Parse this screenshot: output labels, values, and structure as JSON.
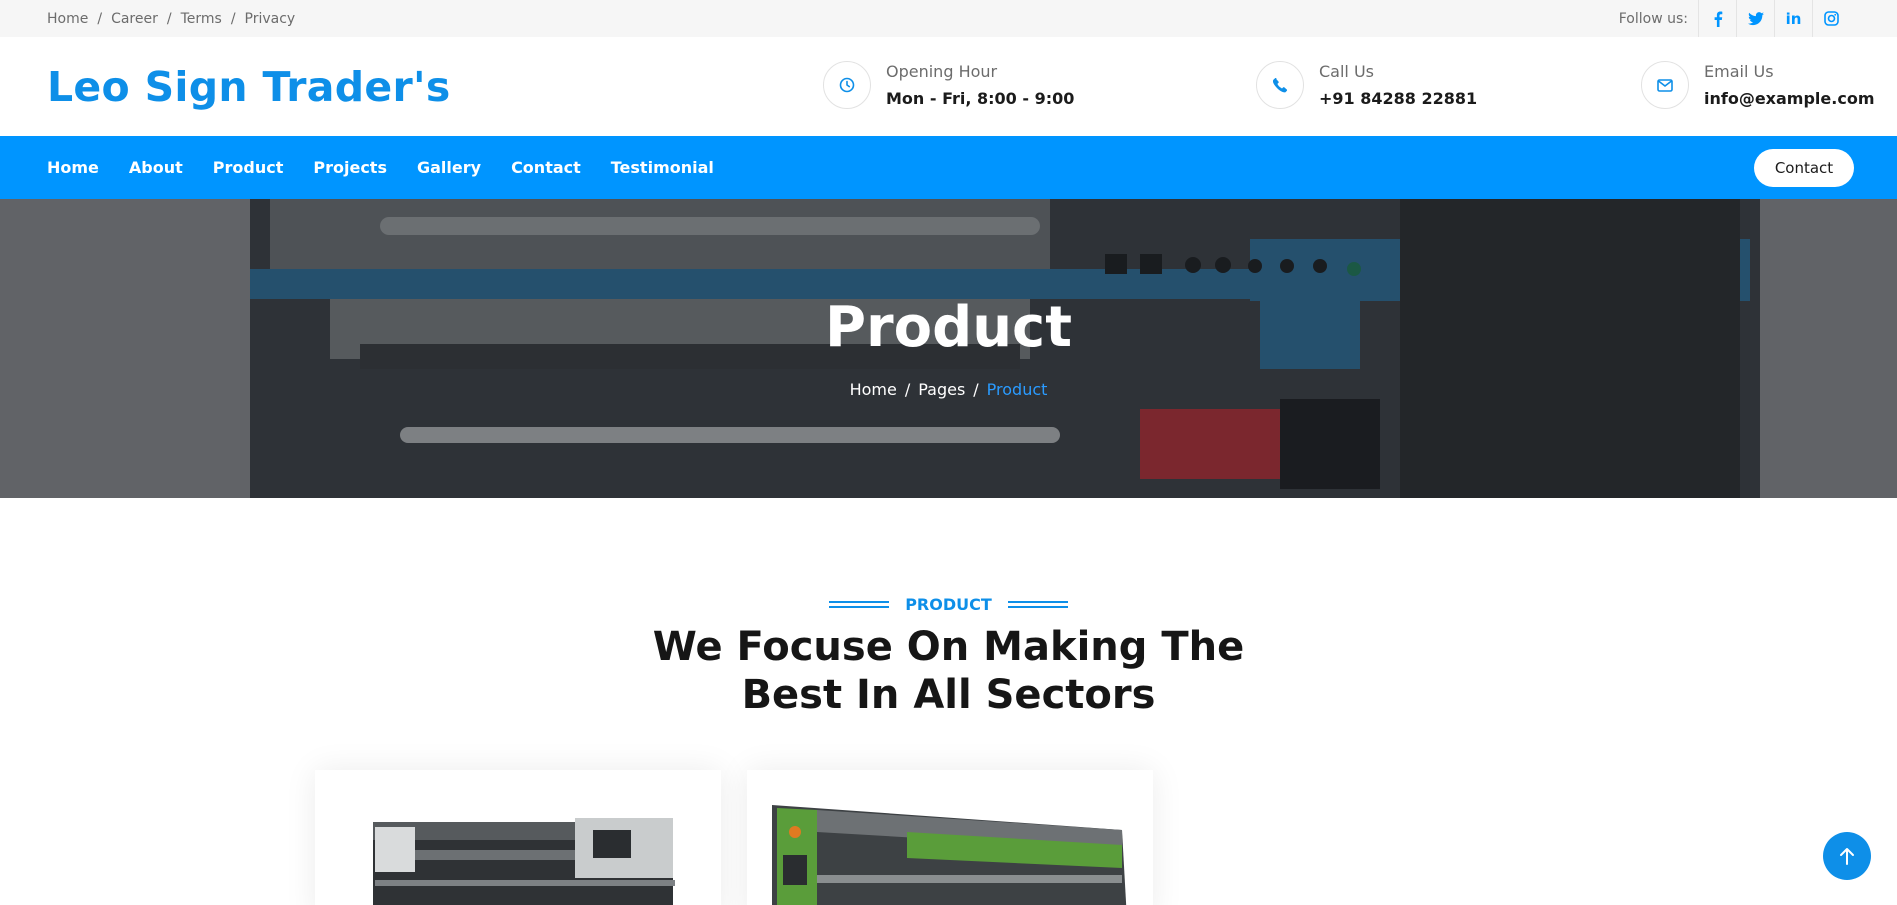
{
  "topbar": {
    "links": [
      "Home",
      "Career",
      "Terms",
      "Privacy"
    ],
    "separator": "/",
    "follow_label": "Follow us:",
    "social": [
      "f",
      "",
      "in",
      ""
    ]
  },
  "header": {
    "logo": "Leo Sign Trader's",
    "opening": {
      "label": "Opening Hour",
      "value": "Mon - Fri, 8:00 - 9:00"
    },
    "call": {
      "label": "Call Us",
      "value": "+91 84288 22881"
    },
    "email": {
      "label": "Email Us",
      "value": "info@example.com"
    }
  },
  "nav": {
    "items": [
      "Home",
      "About",
      "Product",
      "Projects",
      "Gallery",
      "Contact",
      "Testimonial"
    ],
    "cta": "Contact"
  },
  "hero": {
    "title": "Product",
    "breadcrumb": [
      "Home",
      "Pages",
      "Product"
    ],
    "separator": "/"
  },
  "section": {
    "kicker": "PRODUCT",
    "heading_line1": "We Focuse On Making The",
    "heading_line2": "Best In All Sectors"
  },
  "colors": {
    "brand": "#0095ff",
    "logo": "#0e8fe8"
  },
  "icons": {
    "opening": "clock-icon",
    "call": "phone-icon",
    "email": "envelope-icon",
    "back_to_top": "arrow-up-icon"
  }
}
